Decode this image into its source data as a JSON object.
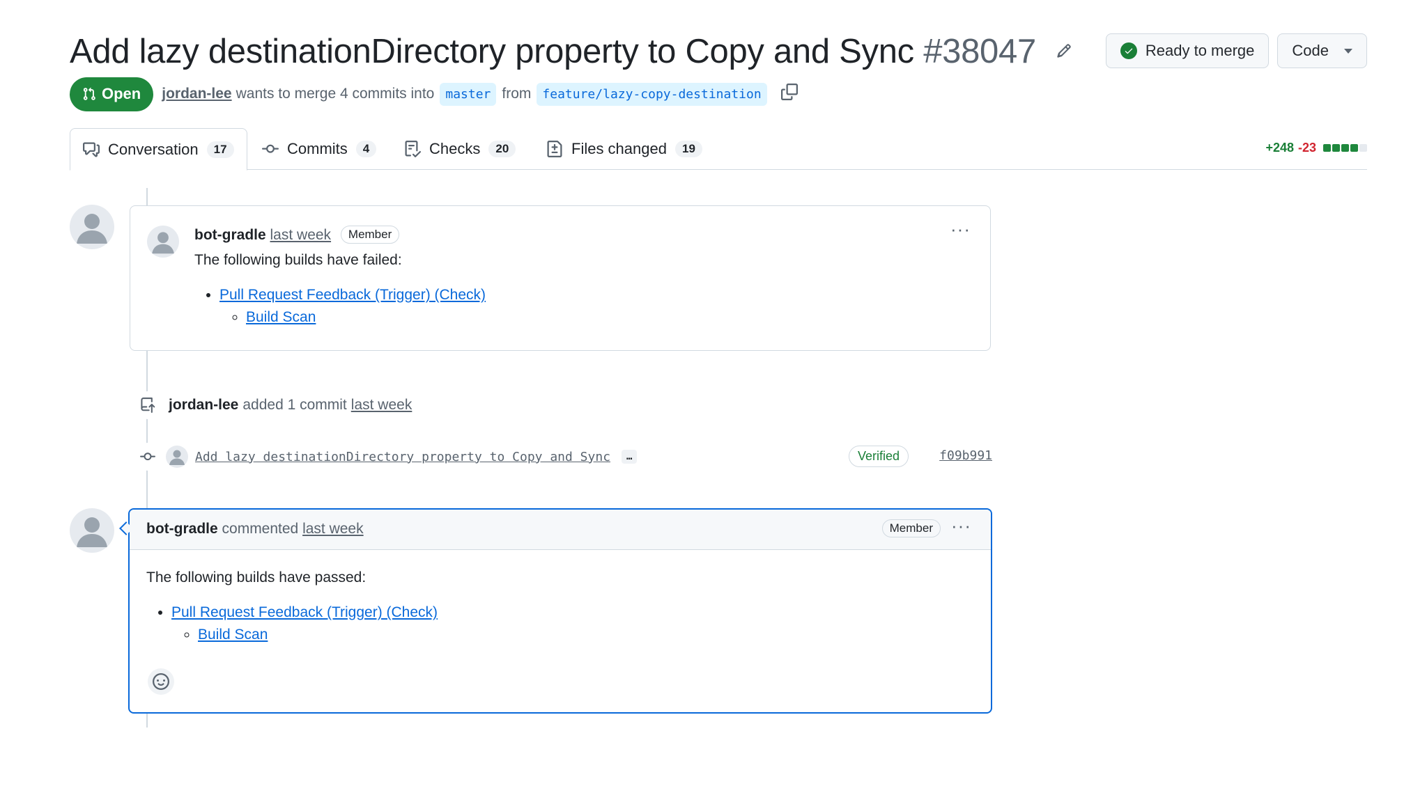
{
  "pr": {
    "title": "Add lazy destinationDirectory property to Copy and Sync",
    "number": "#38047",
    "state": "Open",
    "author": "jordan-lee",
    "merge_text": "wants to merge 4 commits into",
    "base_branch": "master",
    "from_text": "from",
    "head_branch": "feature/lazy-copy-destination"
  },
  "actions": {
    "ready_label": "Ready to merge",
    "code_label": "Code"
  },
  "tabs": [
    {
      "label": "Conversation",
      "count": "17"
    },
    {
      "label": "Commits",
      "count": "4"
    },
    {
      "label": "Checks",
      "count": "20"
    },
    {
      "label": "Files changed",
      "count": "19"
    }
  ],
  "diffstat": {
    "additions": "+248",
    "deletions": "-23"
  },
  "timeline": {
    "comment1": {
      "author": "bot-gradle",
      "time": "last week",
      "role": "Member",
      "intro": "The following builds have failed:",
      "link": "Pull Request Feedback (Trigger) (Check)",
      "sublink": "Build Scan"
    },
    "event": {
      "author": "jordan-lee",
      "action": "added 1 commit",
      "time": "last week"
    },
    "commit": {
      "message": "Add lazy destinationDirectory property to Copy and Sync",
      "expand": "…",
      "verified": "Verified",
      "sha": "f09b991"
    },
    "comment2": {
      "author": "bot-gradle",
      "action": "commented",
      "time": "last week",
      "role": "Member",
      "intro": "The following builds have passed:",
      "link": "Pull Request Feedback (Trigger) (Check)",
      "sublink": "Build Scan"
    }
  },
  "colors": {
    "open_green": "#1f883d",
    "link_blue": "#0969da",
    "add_green": "#1a7f37",
    "del_red": "#d1242f"
  }
}
